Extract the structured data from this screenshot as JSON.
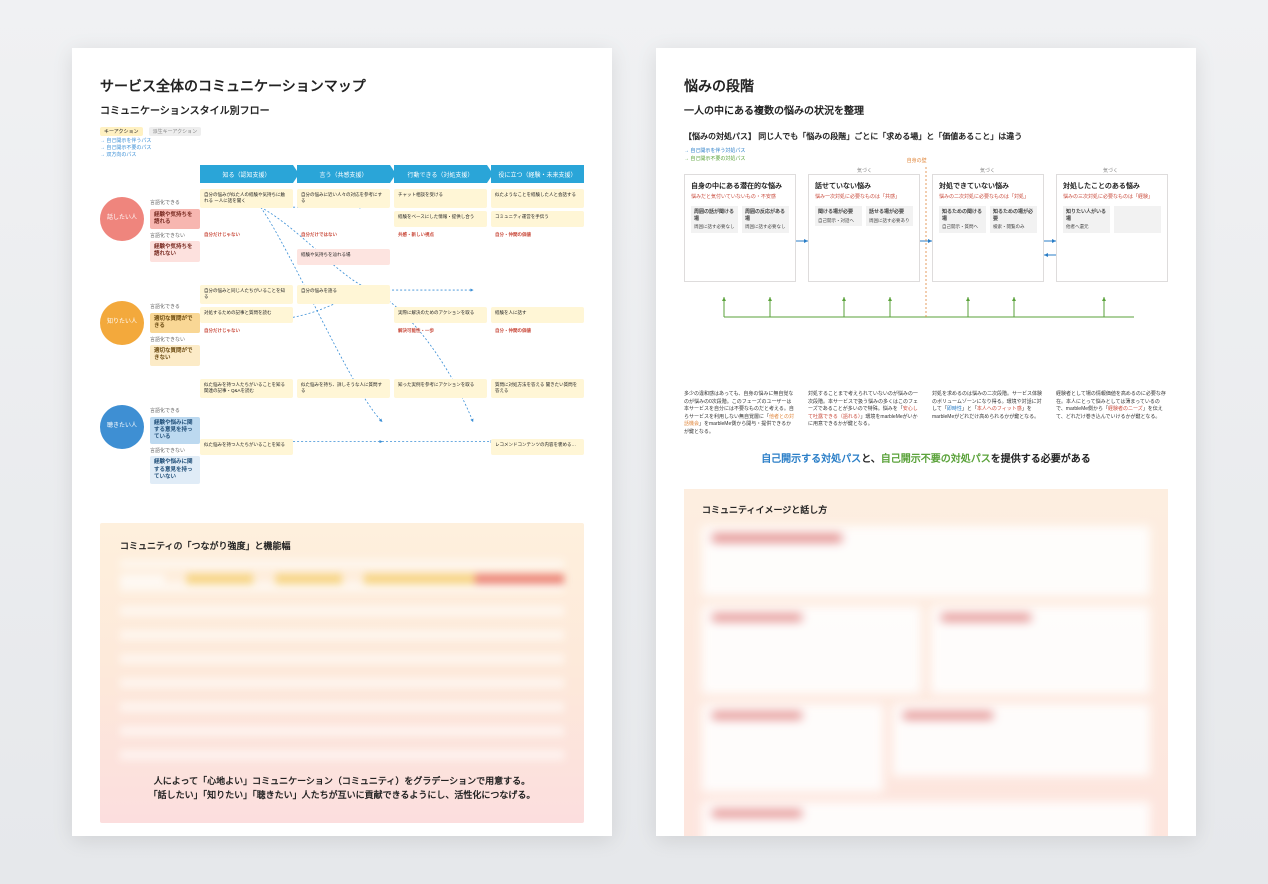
{
  "left": {
    "title": "サービス全体のコミュニケーションマップ",
    "section1_title": "コミュニケーションスタイル別フロー",
    "legend": {
      "chip_key": "キーアクション",
      "chip_derived": "派生キーアクション",
      "flow1": "→ 自己開示を伴うパス",
      "flow2": "→ 自己開示不要のパス",
      "flow3": "→ 双方向のパス"
    },
    "phases": [
      "知る（認知支援）",
      "言う（共感支援）",
      "行動できる（対処支援）",
      "役に立つ（経験・未来支援）"
    ],
    "personas": [
      {
        "circle": "話したい人",
        "labels": [
          {
            "lbl": "言語化できる",
            "bar": "経験や気持ちを語れる",
            "cls": "red"
          },
          {
            "lbl": "言語化できない",
            "bar": "経験や気持ちを語れない",
            "cls": "redlt"
          }
        ]
      },
      {
        "circle": "知りたい人",
        "labels": [
          {
            "lbl": "言語化できる",
            "bar": "適切な質問ができる",
            "cls": "ambr"
          },
          {
            "lbl": "言語化できない",
            "bar": "適切な質問ができない",
            "cls": "amblt"
          }
        ]
      },
      {
        "circle": "聴きたい人",
        "labels": [
          {
            "lbl": "言語化できる",
            "bar": "経験や悩みに関する意見を持っている",
            "cls": "blue"
          },
          {
            "lbl": "言語化できない",
            "bar": "経験や悩みに関する意見を持っていない",
            "cls": "bllt"
          }
        ]
      }
    ],
    "cells": {
      "r0": [
        "自分の悩みが似た人の経験や気持ちに触れる\nー人に話を聞く",
        "自分の悩みに近い人々の対応を参考にする",
        "チャット相談を受ける",
        "似たようなことを経験した人と会話する"
      ],
      "r0b": [
        "",
        "",
        "経験をベースにした情報・提供し合う",
        "コミュニティ運営を手伝う"
      ],
      "r1_red": [
        "自分だけじゃない",
        "自分だけではない",
        "共感・新しい視点",
        "自分・仲間の価値"
      ],
      "r2lbl": [
        "",
        "経験や気持ちを辿れる場",
        "",
        ""
      ],
      "r3": [
        "自分の悩みと同じ人たちがいることを知る",
        "自分の悩みを語る",
        "",
        ""
      ],
      "r3b": [
        "対処するための記事と質問を読む",
        "",
        "実際に解決のためのアクションを取る",
        "経験を人に話す"
      ],
      "r4_red": [
        "自分だけじゃない",
        "",
        "解決可能性・一歩",
        "自分・仲間の価値"
      ],
      "r5": [
        "似た悩みを持つ人たちがいることを知る\n関連の記事・Q&Aを読む",
        "似た悩みを持ち、詳しそうな人に質問する",
        "知った実例を参考にアクションを取る",
        "質問に対処方法を答える\n聞きたい質問を答える"
      ],
      "r6": [
        "似た悩みを持つ人たちがいることを知る",
        "",
        "",
        "レコメンドコンテンツの内容を褒める…"
      ]
    },
    "section2_title": "コミュニティの「つながり強度」と機能幅",
    "caption_l1": "人によって「心地よい」コミュニケーション（コミュニティ）をグラデーションで用意する。",
    "caption_l2": "「話したい」「知りたい」「聴きたい」人たちが互いに貢献できるようにし、活性化につなげる。"
  },
  "right": {
    "title": "悩みの段階",
    "subtitle": "一人の中にある複数の悩みの状況を整理",
    "note": "【悩みの対処パス】 同じ人でも「悩みの段階」ごとに「求める場」と「価値あること」は違う",
    "legend": {
      "blue": "→ 自己開示を伴う対処パス",
      "green": "→ 自己開示不要の対処パス"
    },
    "center_tag": "自身の壁",
    "top_arrows": [
      "気づく",
      "気づく",
      "気づく"
    ],
    "stages": [
      {
        "title": "自身の中にある潜在的な悩み",
        "sub": "悩みだと気付いていないもの・不安感",
        "boxes": [
          {
            "h": "周囲の話が聞ける場",
            "b": "周囲に話す必要なし"
          },
          {
            "h": "周囲の反応がある場",
            "b": "周囲に話す必要なし"
          }
        ]
      },
      {
        "title": "話せていない悩み",
        "sub": "悩み一次対処に必要なものは「共感」",
        "boxes": [
          {
            "h": "聞ける場が必要",
            "b": "自己開示・対話へ"
          },
          {
            "h": "話せる場が必要",
            "b": "周囲に話す必要あり"
          }
        ]
      },
      {
        "title": "対処できていない悩み",
        "sub": "悩みの二次対処に必要なものは「対処」",
        "boxes": [
          {
            "h": "知るための聞ける場",
            "b": "自己開示・質問へ"
          },
          {
            "h": "知るための場が必要",
            "b": "検索・閲覧のみ"
          }
        ]
      },
      {
        "title": "対処したことのある悩み",
        "sub": "悩みの三次対処に必要なものは「経験」",
        "boxes": [
          {
            "h": "知りたい人がいる場",
            "b": "他者へ還元"
          },
          {
            "h": "",
            "b": ""
          }
        ]
      }
    ],
    "stage_desc": [
      "多少の違和感はあっても、自身の悩みに無自覚なのが悩みの0次段階。このフェーズのユーザーは本サービスを自分には不要なものだと考える。自らサービスを利用しない無自覚層に「<o>他者との対話機会</o>」をmarbleMe側から開与・提供できるかが鍵となる。",
      "対処することまで考えられていないのが悩みの一次段階。本サービスで扱う悩みの多くはこのフェーズであることが多いので特殊。悩みを「<r>安心して吐露できる（語れる）</r>」環境をmarbleMeがいかに用意できるかが鍵となる。",
      "対処を求めるのは悩みの二次段階。サービス体験のボリュームゾーンになり得る。環境や対話に対して「<b>即時性</b>」と「<r>本人へのフィット感</r>」をmarbleMeがどれだけ高められるかが鍵となる。",
      "経験者として場の情報価値を高めるのに必要な存在。本人にとって悩みとしては薄まっているので、marbleMe側から「<r>経験者のニーズ</r>」を伝えて、どれだけ巻き込んでいけるかが鍵となる。"
    ],
    "conclusion": {
      "blue": "自己開示する対処パス",
      "mid": "と、",
      "green": "自己開示不要の対処パス",
      "tail": "を提供する必要がある"
    },
    "ci_title": "コミュニティイメージと話し方"
  }
}
